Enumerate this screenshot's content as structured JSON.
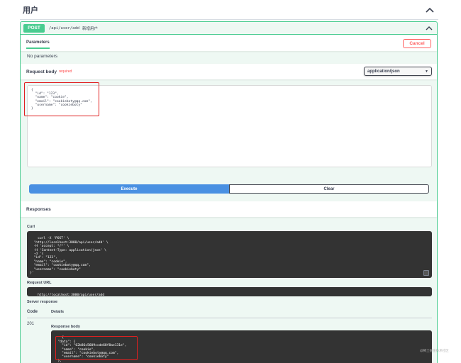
{
  "tag": {
    "title": "用户"
  },
  "operation": {
    "method": "POST",
    "path": "/api/user/add",
    "description": "新增用户"
  },
  "parameters": {
    "tab_label": "Parameters",
    "cancel_label": "Cancel",
    "no_params_text": "No parameters"
  },
  "request_body": {
    "label": "Request body",
    "required_label": "required",
    "content_type": "application/json",
    "json_text": "{\n  \"id\": \"123\",\n  \"name\": \"cookie\",\n  \"email\": \"cookieboty@qq.com\",\n  \"username\": \"cookieboty\"\n}"
  },
  "actions": {
    "execute_label": "Execute",
    "clear_label": "Clear"
  },
  "responses": {
    "header": "Responses",
    "curl_label": "Curl",
    "curl_text": "curl -X 'POST' \\\n  'http://localhost:3000/api/user/add' \\\n  -H 'accept: */*' \\\n  -H 'Content-Type: application/json' \\\n  -d '{\n  \"id\": \"123\",\n  \"name\": \"cookie\",\n  \"email\": \"cookieboty@qq.com\",\n  \"username\": \"cookieboty\"\n}'",
    "request_url_label": "Request URL",
    "request_url": "http://localhost:3000/api/user/add",
    "server_response_label": "Server response",
    "code_header": "Code",
    "details_header": "Details",
    "code": "201",
    "response_body_label": "Response body",
    "response_body_text": "{\n  \"data\": {\n    \"id\": \"62b86c5609ccde68f8ae131e\",\n    \"name\": \"cookie\",\n    \"email\": \"cookieboty@qq.com\",\n    \"username\": \"cookieboty\"\n  },"
  },
  "watermark": "@稀土掘金技术社区",
  "colors": {
    "post_green": "#49cc90",
    "execute_blue": "#4990e2",
    "cancel_red": "#ff6060",
    "highlight_red": "#e02020"
  }
}
